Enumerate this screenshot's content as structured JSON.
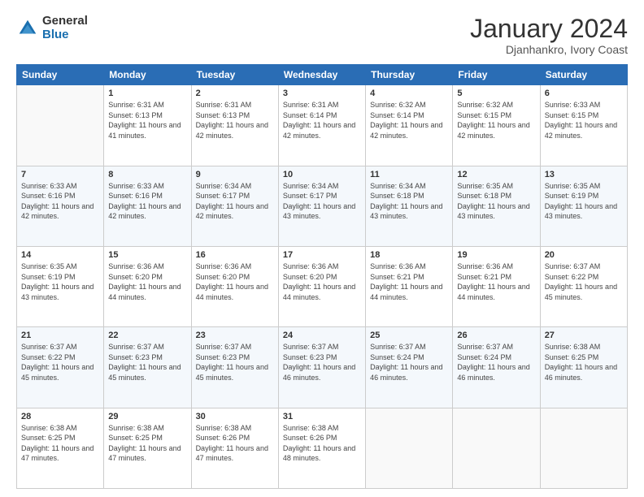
{
  "logo": {
    "general": "General",
    "blue": "Blue"
  },
  "header": {
    "month": "January 2024",
    "location": "Djanhankro, Ivory Coast"
  },
  "weekdays": [
    "Sunday",
    "Monday",
    "Tuesday",
    "Wednesday",
    "Thursday",
    "Friday",
    "Saturday"
  ],
  "weeks": [
    [
      {
        "day": "",
        "sunrise": "",
        "sunset": "",
        "daylight": ""
      },
      {
        "day": "1",
        "sunrise": "Sunrise: 6:31 AM",
        "sunset": "Sunset: 6:13 PM",
        "daylight": "Daylight: 11 hours and 41 minutes."
      },
      {
        "day": "2",
        "sunrise": "Sunrise: 6:31 AM",
        "sunset": "Sunset: 6:13 PM",
        "daylight": "Daylight: 11 hours and 42 minutes."
      },
      {
        "day": "3",
        "sunrise": "Sunrise: 6:31 AM",
        "sunset": "Sunset: 6:14 PM",
        "daylight": "Daylight: 11 hours and 42 minutes."
      },
      {
        "day": "4",
        "sunrise": "Sunrise: 6:32 AM",
        "sunset": "Sunset: 6:14 PM",
        "daylight": "Daylight: 11 hours and 42 minutes."
      },
      {
        "day": "5",
        "sunrise": "Sunrise: 6:32 AM",
        "sunset": "Sunset: 6:15 PM",
        "daylight": "Daylight: 11 hours and 42 minutes."
      },
      {
        "day": "6",
        "sunrise": "Sunrise: 6:33 AM",
        "sunset": "Sunset: 6:15 PM",
        "daylight": "Daylight: 11 hours and 42 minutes."
      }
    ],
    [
      {
        "day": "7",
        "sunrise": "Sunrise: 6:33 AM",
        "sunset": "Sunset: 6:16 PM",
        "daylight": "Daylight: 11 hours and 42 minutes."
      },
      {
        "day": "8",
        "sunrise": "Sunrise: 6:33 AM",
        "sunset": "Sunset: 6:16 PM",
        "daylight": "Daylight: 11 hours and 42 minutes."
      },
      {
        "day": "9",
        "sunrise": "Sunrise: 6:34 AM",
        "sunset": "Sunset: 6:17 PM",
        "daylight": "Daylight: 11 hours and 42 minutes."
      },
      {
        "day": "10",
        "sunrise": "Sunrise: 6:34 AM",
        "sunset": "Sunset: 6:17 PM",
        "daylight": "Daylight: 11 hours and 43 minutes."
      },
      {
        "day": "11",
        "sunrise": "Sunrise: 6:34 AM",
        "sunset": "Sunset: 6:18 PM",
        "daylight": "Daylight: 11 hours and 43 minutes."
      },
      {
        "day": "12",
        "sunrise": "Sunrise: 6:35 AM",
        "sunset": "Sunset: 6:18 PM",
        "daylight": "Daylight: 11 hours and 43 minutes."
      },
      {
        "day": "13",
        "sunrise": "Sunrise: 6:35 AM",
        "sunset": "Sunset: 6:19 PM",
        "daylight": "Daylight: 11 hours and 43 minutes."
      }
    ],
    [
      {
        "day": "14",
        "sunrise": "Sunrise: 6:35 AM",
        "sunset": "Sunset: 6:19 PM",
        "daylight": "Daylight: 11 hours and 43 minutes."
      },
      {
        "day": "15",
        "sunrise": "Sunrise: 6:36 AM",
        "sunset": "Sunset: 6:20 PM",
        "daylight": "Daylight: 11 hours and 44 minutes."
      },
      {
        "day": "16",
        "sunrise": "Sunrise: 6:36 AM",
        "sunset": "Sunset: 6:20 PM",
        "daylight": "Daylight: 11 hours and 44 minutes."
      },
      {
        "day": "17",
        "sunrise": "Sunrise: 6:36 AM",
        "sunset": "Sunset: 6:20 PM",
        "daylight": "Daylight: 11 hours and 44 minutes."
      },
      {
        "day": "18",
        "sunrise": "Sunrise: 6:36 AM",
        "sunset": "Sunset: 6:21 PM",
        "daylight": "Daylight: 11 hours and 44 minutes."
      },
      {
        "day": "19",
        "sunrise": "Sunrise: 6:36 AM",
        "sunset": "Sunset: 6:21 PM",
        "daylight": "Daylight: 11 hours and 44 minutes."
      },
      {
        "day": "20",
        "sunrise": "Sunrise: 6:37 AM",
        "sunset": "Sunset: 6:22 PM",
        "daylight": "Daylight: 11 hours and 45 minutes."
      }
    ],
    [
      {
        "day": "21",
        "sunrise": "Sunrise: 6:37 AM",
        "sunset": "Sunset: 6:22 PM",
        "daylight": "Daylight: 11 hours and 45 minutes."
      },
      {
        "day": "22",
        "sunrise": "Sunrise: 6:37 AM",
        "sunset": "Sunset: 6:23 PM",
        "daylight": "Daylight: 11 hours and 45 minutes."
      },
      {
        "day": "23",
        "sunrise": "Sunrise: 6:37 AM",
        "sunset": "Sunset: 6:23 PM",
        "daylight": "Daylight: 11 hours and 45 minutes."
      },
      {
        "day": "24",
        "sunrise": "Sunrise: 6:37 AM",
        "sunset": "Sunset: 6:23 PM",
        "daylight": "Daylight: 11 hours and 46 minutes."
      },
      {
        "day": "25",
        "sunrise": "Sunrise: 6:37 AM",
        "sunset": "Sunset: 6:24 PM",
        "daylight": "Daylight: 11 hours and 46 minutes."
      },
      {
        "day": "26",
        "sunrise": "Sunrise: 6:37 AM",
        "sunset": "Sunset: 6:24 PM",
        "daylight": "Daylight: 11 hours and 46 minutes."
      },
      {
        "day": "27",
        "sunrise": "Sunrise: 6:38 AM",
        "sunset": "Sunset: 6:25 PM",
        "daylight": "Daylight: 11 hours and 46 minutes."
      }
    ],
    [
      {
        "day": "28",
        "sunrise": "Sunrise: 6:38 AM",
        "sunset": "Sunset: 6:25 PM",
        "daylight": "Daylight: 11 hours and 47 minutes."
      },
      {
        "day": "29",
        "sunrise": "Sunrise: 6:38 AM",
        "sunset": "Sunset: 6:25 PM",
        "daylight": "Daylight: 11 hours and 47 minutes."
      },
      {
        "day": "30",
        "sunrise": "Sunrise: 6:38 AM",
        "sunset": "Sunset: 6:26 PM",
        "daylight": "Daylight: 11 hours and 47 minutes."
      },
      {
        "day": "31",
        "sunrise": "Sunrise: 6:38 AM",
        "sunset": "Sunset: 6:26 PM",
        "daylight": "Daylight: 11 hours and 48 minutes."
      },
      {
        "day": "",
        "sunrise": "",
        "sunset": "",
        "daylight": ""
      },
      {
        "day": "",
        "sunrise": "",
        "sunset": "",
        "daylight": ""
      },
      {
        "day": "",
        "sunrise": "",
        "sunset": "",
        "daylight": ""
      }
    ]
  ]
}
